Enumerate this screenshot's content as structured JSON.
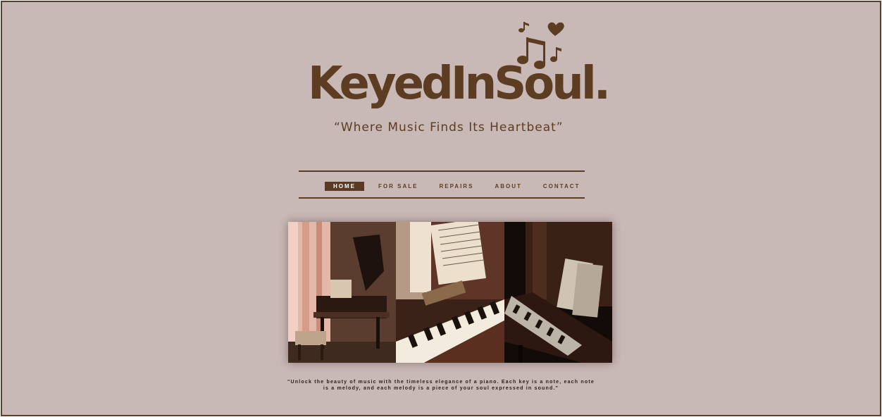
{
  "brand": {
    "name": "KeyedInSoul.",
    "tagline": "“Where Music Finds Its Heartbeat”",
    "icon": "music-notes-heart-icon"
  },
  "nav": {
    "items": [
      {
        "label": "HOME",
        "active": true
      },
      {
        "label": "FOR SALE",
        "active": false
      },
      {
        "label": "REPAIRS",
        "active": false
      },
      {
        "label": "ABOUT",
        "active": false
      },
      {
        "label": "CONTACT",
        "active": false
      }
    ]
  },
  "hero": {
    "panels": [
      "grand-piano-photo",
      "upright-piano-sheet-music-photo",
      "dark-upright-piano-photo"
    ]
  },
  "quote": {
    "line1": "\"Unlock the beauty of music with the timeless elegance of a piano. Each key is a note, each note",
    "line2": "is a melody, and each melody is a piece of your soul expressed in sound.\""
  },
  "colors": {
    "background": "#c8b8b6",
    "brand_brown": "#5c3d22",
    "active_nav": "#5a3a22"
  }
}
